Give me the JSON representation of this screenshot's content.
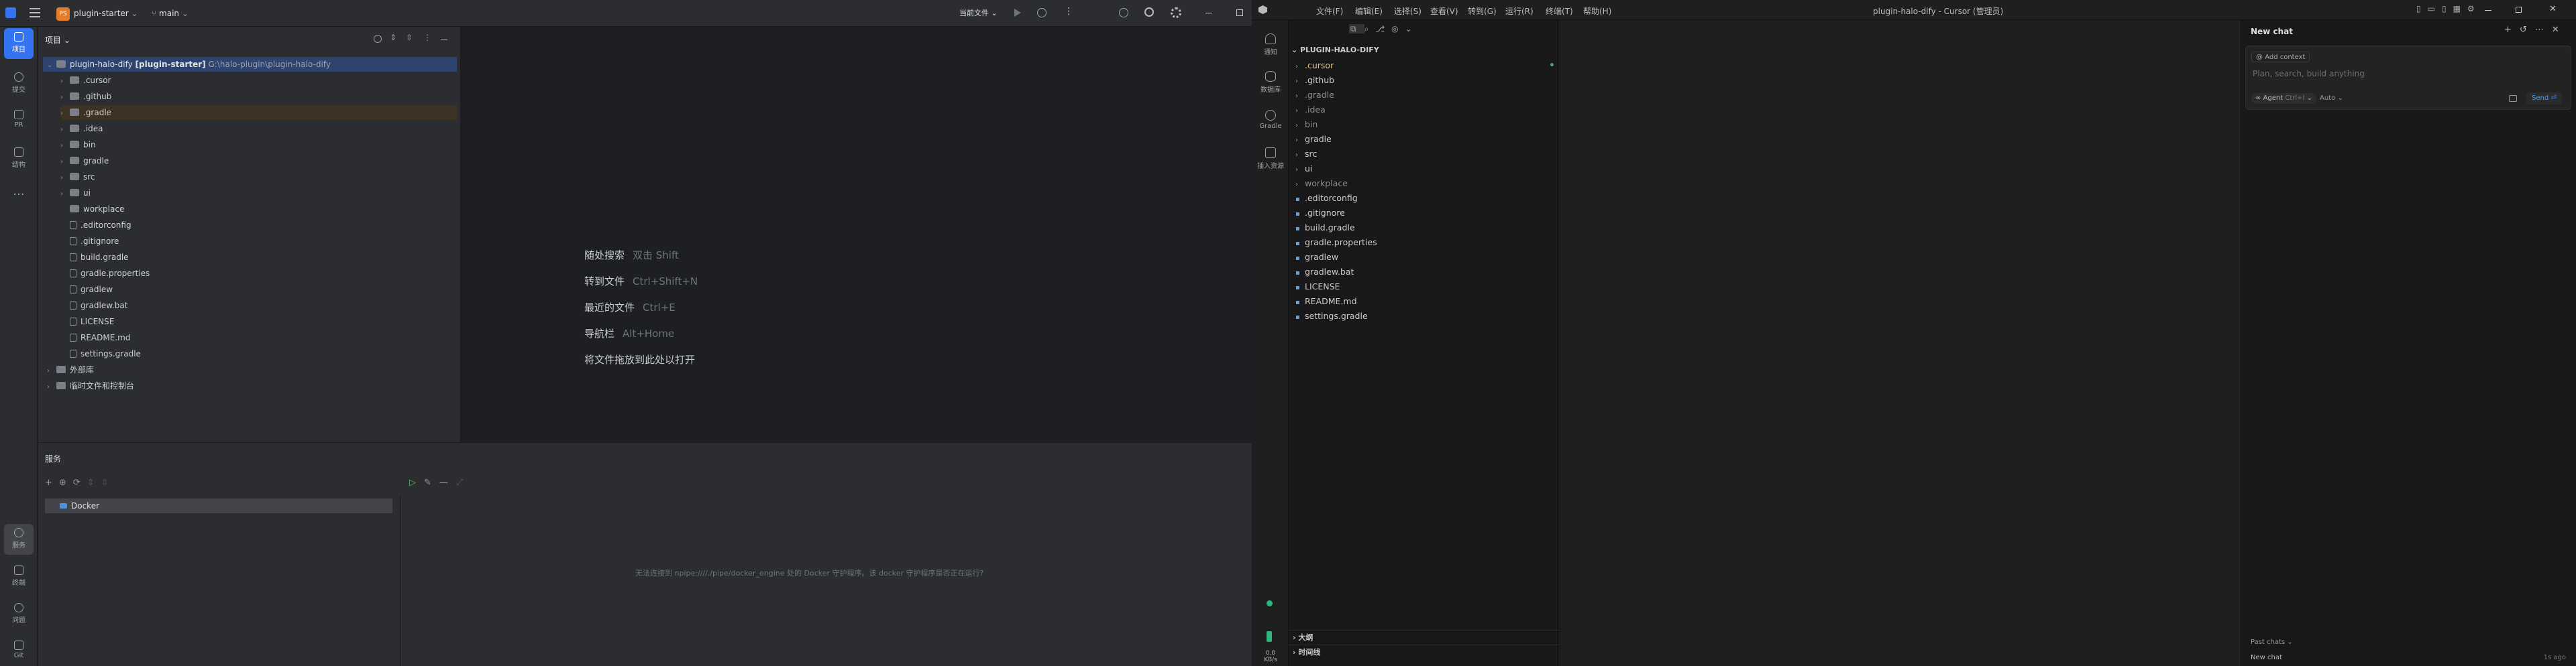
{
  "ide": {
    "project_name": "plugin-starter",
    "project_badge": "PS",
    "branch": "main",
    "current_file": "当前文件",
    "stripe": [
      "项目",
      "提交",
      "PR",
      "结构"
    ],
    "stripe_bottom": [
      "服务",
      "终端",
      "问题",
      "Git"
    ],
    "project_panel_title": "项目",
    "root_label": "plugin-halo-dify",
    "root_module": "[plugin-starter]",
    "root_path": "G:\\halo-plugin\\plugin-halo-dify",
    "tree": [
      {
        "label": ".cursor",
        "folder": true,
        "chev": true,
        "depth": 1
      },
      {
        "label": ".github",
        "folder": true,
        "chev": true,
        "depth": 1
      },
      {
        "label": ".gradle",
        "folder": true,
        "chev": true,
        "depth": 1,
        "highlight": true
      },
      {
        "label": ".idea",
        "folder": true,
        "chev": true,
        "depth": 1
      },
      {
        "label": "bin",
        "folder": true,
        "chev": true,
        "depth": 1
      },
      {
        "label": "gradle",
        "folder": true,
        "chev": true,
        "depth": 1
      },
      {
        "label": "src",
        "folder": true,
        "chev": true,
        "depth": 1
      },
      {
        "label": "ui",
        "folder": true,
        "chev": true,
        "depth": 1
      },
      {
        "label": "workplace",
        "folder": true,
        "chev": false,
        "depth": 1
      },
      {
        "label": ".editorconfig",
        "folder": false,
        "depth": 1
      },
      {
        "label": ".gitignore",
        "folder": false,
        "depth": 1
      },
      {
        "label": "build.gradle",
        "folder": false,
        "depth": 1
      },
      {
        "label": "gradle.properties",
        "folder": false,
        "depth": 1
      },
      {
        "label": "gradlew",
        "folder": false,
        "depth": 1
      },
      {
        "label": "gradlew.bat",
        "folder": false,
        "depth": 1
      },
      {
        "label": "LICENSE",
        "folder": false,
        "depth": 1
      },
      {
        "label": "README.md",
        "folder": false,
        "depth": 1
      },
      {
        "label": "settings.gradle",
        "folder": false,
        "depth": 1
      },
      {
        "label": "外部库",
        "folder": true,
        "chev": true,
        "depth": 0
      },
      {
        "label": "临时文件和控制台",
        "folder": true,
        "chev": true,
        "depth": 0
      }
    ],
    "hints": [
      {
        "label": "随处搜索",
        "key": "双击 Shift"
      },
      {
        "label": "转到文件",
        "key": "Ctrl+Shift+N"
      },
      {
        "label": "最近的文件",
        "key": "Ctrl+E"
      },
      {
        "label": "导航栏",
        "key": "Alt+Home"
      },
      {
        "label": "将文件拖放到此处以打开",
        "key": ""
      }
    ],
    "services_title": "服务",
    "docker_label": "Docker",
    "docker_message": "无法连接到 npipe:////./pipe/docker_engine 处的 Docker 守护程序。该 docker 守护程序是否正在运行?"
  },
  "cursor": {
    "menu": [
      "文件(F)",
      "编辑(E)",
      "选择(S)",
      "查看(V)",
      "转到(G)",
      "运行(R)",
      "终端(T)",
      "帮助(H)"
    ],
    "window_title": "plugin-halo-dify - Cursor (管理员)",
    "side": [
      "通知",
      "数据库",
      "Gradle",
      "插入资源"
    ],
    "side_status_value": "0.0",
    "side_status_unit": "KB/s",
    "explorer_title": "PLUGIN-HALO-DIFY",
    "tree": [
      {
        "label": ".cursor",
        "chev": true,
        "color": "#e2c08d"
      },
      {
        "label": ".github",
        "chev": true,
        "color": "#cccccc"
      },
      {
        "label": ".gradle",
        "chev": true,
        "color": "#8c8c8c"
      },
      {
        "label": ".idea",
        "chev": true,
        "color": "#8c8c8c"
      },
      {
        "label": "bin",
        "chev": true,
        "color": "#8c8c8c"
      },
      {
        "label": "gradle",
        "chev": true,
        "color": "#cccccc"
      },
      {
        "label": "src",
        "chev": true,
        "color": "#cccccc"
      },
      {
        "label": "ui",
        "chev": true,
        "color": "#cccccc"
      },
      {
        "label": "workplace",
        "chev": true,
        "color": "#8c8c8c"
      },
      {
        "label": ".editorconfig",
        "chev": false,
        "color": "#cccccc"
      },
      {
        "label": ".gitignore",
        "chev": false,
        "color": "#cccccc"
      },
      {
        "label": "build.gradle",
        "chev": false,
        "color": "#cccccc"
      },
      {
        "label": "gradle.properties",
        "chev": false,
        "color": "#cccccc"
      },
      {
        "label": "gradlew",
        "chev": false,
        "color": "#cccccc"
      },
      {
        "label": "gradlew.bat",
        "chev": false,
        "color": "#cccccc"
      },
      {
        "label": "LICENSE",
        "chev": false,
        "color": "#cccccc"
      },
      {
        "label": "README.md",
        "chev": false,
        "color": "#cccccc"
      },
      {
        "label": "settings.gradle",
        "chev": false,
        "color": "#cccccc"
      }
    ],
    "outline_label": "大纲",
    "timeline_label": "时间线",
    "chat_title": "New chat",
    "add_context": "Add context",
    "chat_placeholder": "Plan, search, build anything",
    "agent_label": "Agent",
    "agent_shortcut": "Ctrl+I",
    "auto_label": "Auto",
    "send_label": "Send",
    "past_chats": "Past chats",
    "new_chat_item": "New chat",
    "new_chat_time": "1s ago"
  },
  "colors": {
    "accent": "#3574f0",
    "selection": "#2e436e",
    "highlight": "#3d3223"
  }
}
